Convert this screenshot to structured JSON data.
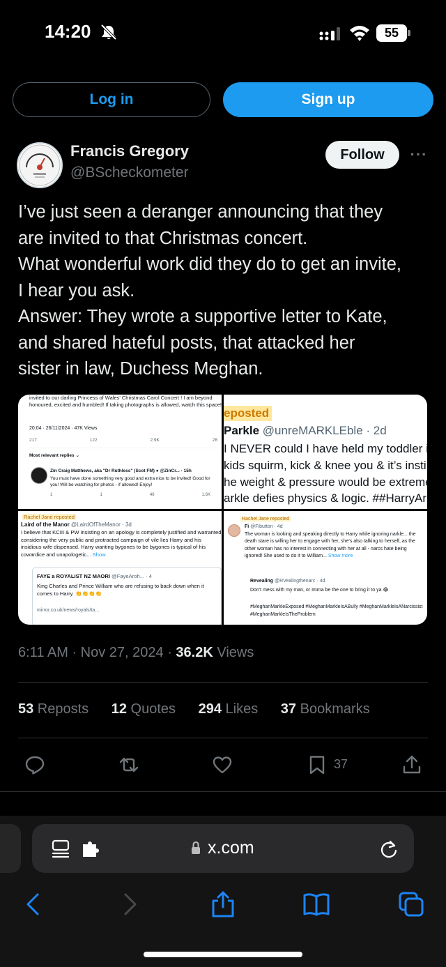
{
  "status_bar": {
    "time": "14:20",
    "battery": "55"
  },
  "auth": {
    "login_label": "Log in",
    "signup_label": "Sign up"
  },
  "author": {
    "name": "Francis Gregory",
    "handle": "@BScheckometer",
    "follow_label": "Follow"
  },
  "tweet": {
    "lines": [
      "I’ve just seen a deranger announcing that they",
      "are invited to that Christmas concert.",
      "What wonderful work did they do to get an invite,",
      "I hear you ask.",
      "Answer: They wrote a supportive letter to Kate,",
      "and shared hateful posts, that attacked her",
      "sister in law, Duchess Meghan."
    ]
  },
  "media": {
    "top_left": {
      "quote": "invited to our darling Princess of Wales' Christmas Carol Concert ! I am beyond honoured, excited and humbled! If taking photographs is allowed, watch this space!",
      "meta": "20:04 · 26/11/2024 · 47K Views",
      "actions": [
        "217",
        "122",
        "2.9K",
        "28"
      ],
      "replies_label": "Most relevant replies ⌄",
      "reply_name": "Zin Craig Matthews, aka \"Dr Ruthless\" (Scot FM) ● @ZinCr... · 15h",
      "reply_text": "You must have done something very good and extra nice to be invited! Good for you! Will be watching for photos - if allowed! Enjoy!",
      "reply_actions": [
        "1",
        "1",
        "46",
        "1.6K"
      ]
    },
    "top_right": {
      "badge": "eposted",
      "author_name": "Parkle",
      "author_handle": "@unreMARKLEble · 2d",
      "lines": [
        "I NEVER could I have held my toddler i",
        "kids squirm, kick & knee you & it’s insti",
        "he weight & pressure would be extreme",
        "arkle defies physics & logic. ##HarryAr"
      ]
    },
    "bottom_left": {
      "badge": "Rachel Jane reposted",
      "author_name": "Laird of the Manor",
      "author_handle": "@LairdOfTheManor · 3d",
      "text": "I believe that KCIII & PW insisting on an apology is completely justified and warranted considering the very public and protracted campaign of vile lies Harry and his insidious wife dispensed. Harry wanting bygones to be bygones is typical of his cowardice and unapologetic...",
      "show_more": "Show",
      "quote_author": "FAYE a ROYALIST NZ MAORI",
      "quote_handle": "@FayeAroh... · 4",
      "quote_text": "King Charles and Prince William who are refusing to back down when it comes to Harry. 👏👏👏👏",
      "quote_link": "mirror.co.uk/news/royals/ta..."
    },
    "bottom_right": {
      "badge": "Rachel Jane reposted",
      "author_name": "Fi",
      "author_handle": "@Fibutton · 4d",
      "text": "The woman is looking and speaking directly to Harry while ignoring narkle... the death stare is willing her to engage with her, she's also talking to herself, as the other woman has no interest in connecting with her at all - narcs hate being ignored! She used to do it to William...",
      "show_more": "Show more",
      "quote_author": "Revealing",
      "quote_handle": "@RVealingthenarc · 4d",
      "quote_text": "Don't mess with my man, or Imma be the one to bring it to ya 😂",
      "tags": "#MeghanMarkleExposed #MeghanMarkleIsABully #MeghanMarkleIsANarcissist #MeghanMarkleIsTheProblem"
    }
  },
  "meta": {
    "time": "6:11 AM · Nov 27, 2024 · ",
    "views": "36.2K",
    "views_label": " Views"
  },
  "stats": [
    {
      "value": "53",
      "label": " Reposts"
    },
    {
      "value": "12",
      "label": " Quotes"
    },
    {
      "value": "294",
      "label": " Likes"
    },
    {
      "value": "37",
      "label": " Bookmarks"
    }
  ],
  "action_bar": {
    "bookmark_count": "37"
  },
  "browser": {
    "url": "x.com"
  },
  "colors": {
    "accent": "#1d9bf0",
    "background": "#000000",
    "muted": "#71767b"
  },
  "icons": [
    "bell-slash-icon",
    "signal-icon",
    "wifi-icon",
    "more-icon",
    "reply-icon",
    "repost-icon",
    "like-icon",
    "bookmark-icon",
    "share-icon",
    "reader-icon",
    "extension-icon",
    "lock-icon",
    "reload-icon",
    "back-icon",
    "forward-icon",
    "share-sheet-icon",
    "bookmarks-book-icon",
    "tabs-icon"
  ]
}
